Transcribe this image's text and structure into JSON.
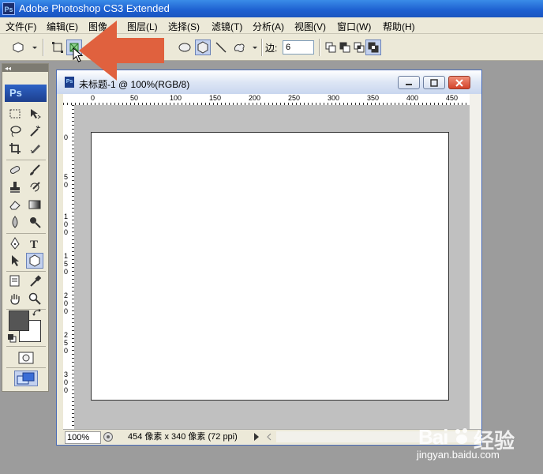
{
  "app": {
    "icon_label": "Ps",
    "title": "Adobe Photoshop CS3 Extended"
  },
  "menu": [
    "文件(F)",
    "编辑(E)",
    "图像",
    "图层(L)",
    "选择(S)",
    "滤镜(T)",
    "分析(A)",
    "视图(V)",
    "窗口(W)",
    "帮助(H)"
  ],
  "options": {
    "sides_label": "边:",
    "sides_value": "6"
  },
  "toolbox": {
    "logo": "Ps"
  },
  "document": {
    "title": "未标题-1 @ 100%(RGB/8)",
    "ruler_h_labels": [
      "0",
      "50",
      "100",
      "150",
      "200",
      "250",
      "300",
      "350",
      "400",
      "450"
    ],
    "ruler_v_labels": [
      "0",
      "5 0",
      "1 0 0",
      "1 5 0",
      "2 0 0",
      "2 5 0",
      "3 0 0"
    ],
    "zoom": "100%",
    "status": "454 像素 x 340 像素 (72 ppi)"
  },
  "colors": {
    "accent": "#1d5fd0",
    "arrow": "#e0613e",
    "foreground": "#555555",
    "background": "#ffffff"
  },
  "watermark": {
    "brand": "Bai",
    "brand2": "经验",
    "url": "jingyan.baidu.com"
  }
}
